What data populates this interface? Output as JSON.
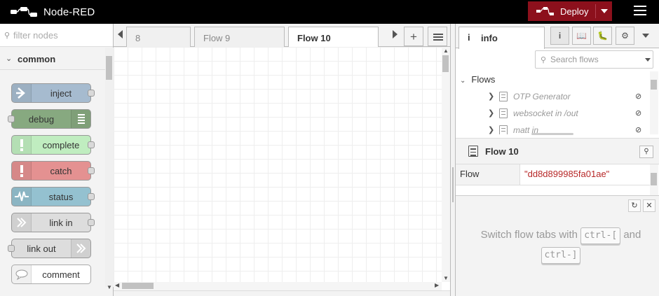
{
  "header": {
    "app_title": "Node-RED",
    "deploy_label": "Deploy",
    "colors": {
      "header_bg": "#000000",
      "deploy_bg": "#8c101c"
    }
  },
  "palette": {
    "search_placeholder": "filter nodes",
    "category": "common",
    "nodes": [
      {
        "label": "inject",
        "color": "#a6bbcf",
        "icon": "arrow-right-icon",
        "icon_side": "left",
        "input": false,
        "output": true
      },
      {
        "label": "debug",
        "color": "#87a980",
        "icon": "list-icon",
        "icon_side": "right",
        "input": true,
        "output": false
      },
      {
        "label": "complete",
        "color": "#c0edc0",
        "icon": "exclamation-icon",
        "icon_side": "left",
        "input": false,
        "output": true
      },
      {
        "label": "catch",
        "color": "#e49191",
        "icon": "exclamation-icon",
        "icon_side": "left",
        "input": false,
        "output": true
      },
      {
        "label": "status",
        "color": "#94c1d0",
        "icon": "pulse-icon",
        "icon_side": "left",
        "input": false,
        "output": true
      },
      {
        "label": "link in",
        "color": "#dddddd",
        "icon": "link-arrow-icon",
        "icon_side": "left",
        "input": false,
        "output": true
      },
      {
        "label": "link out",
        "color": "#dddddd",
        "icon": "link-arrow-icon",
        "icon_side": "right",
        "input": true,
        "output": false
      },
      {
        "label": "comment",
        "color": "#ffffff",
        "icon": "speech-bubble-icon",
        "icon_side": "left",
        "input": false,
        "output": false
      }
    ]
  },
  "workspace": {
    "tabs": [
      {
        "label": "8",
        "active": false
      },
      {
        "label": "Flow 9",
        "active": false
      },
      {
        "label": "Flow 10",
        "active": true
      }
    ]
  },
  "sidebar": {
    "active_tab": {
      "icon": "i",
      "label": "info"
    },
    "search_placeholder": "Search flows",
    "tree_root": "Flows",
    "flows": [
      {
        "label": "OTP Generator"
      },
      {
        "label": "websocket in /out"
      },
      {
        "label": "matt in"
      }
    ],
    "selected": {
      "title": "Flow 10",
      "prop_key": "Flow",
      "prop_value": "\"dd8d899985fa01ae\""
    },
    "tip": {
      "pre": "Switch flow tabs with",
      "key1": "ctrl-[",
      "mid": "and",
      "key2": "ctrl-]"
    }
  }
}
